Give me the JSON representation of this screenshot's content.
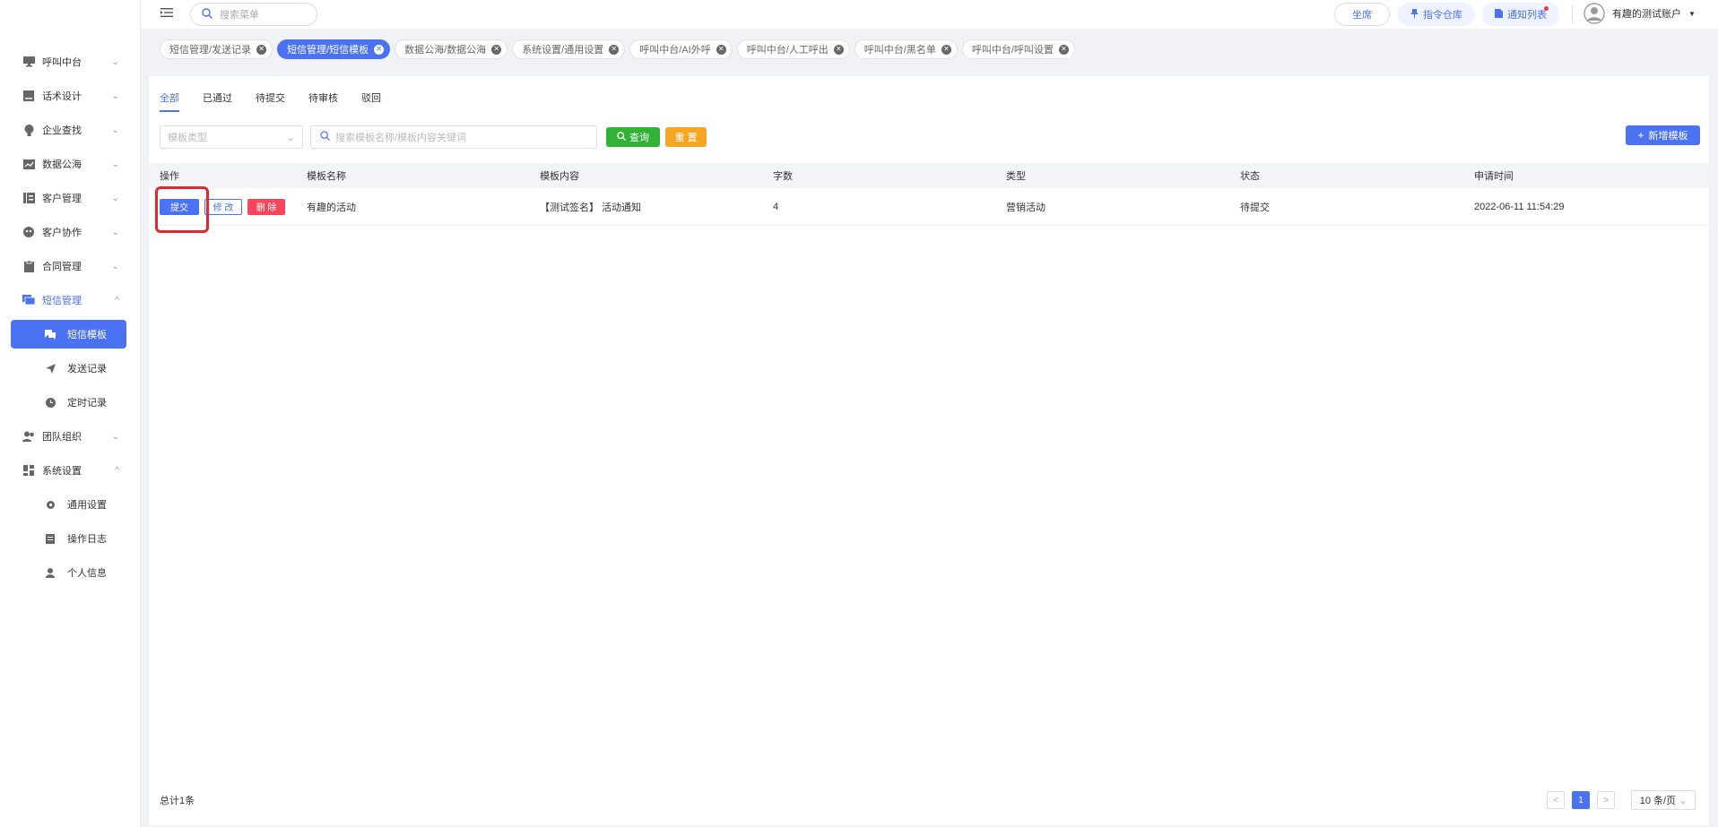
{
  "topbar": {
    "search_placeholder": "搜索菜单",
    "seat_label": "坐席",
    "command_label": "指令仓库",
    "notice_label": "通知列表",
    "user_name": "有趣的测试账户"
  },
  "sidebar": {
    "items": [
      {
        "label": "呼叫中台",
        "icon": "monitor-icon",
        "arrow": "v"
      },
      {
        "label": "话术设计",
        "icon": "script-icon",
        "arrow": "v"
      },
      {
        "label": "企业查找",
        "icon": "bulb-icon",
        "arrow": "v"
      },
      {
        "label": "数据公海",
        "icon": "chart-icon",
        "arrow": "v"
      },
      {
        "label": "客户管理",
        "icon": "customer-icon",
        "arrow": "v"
      },
      {
        "label": "客户协作",
        "icon": "globe-icon",
        "arrow": "v"
      },
      {
        "label": "合同管理",
        "icon": "clipboard-icon",
        "arrow": "v"
      },
      {
        "label": "短信管理",
        "icon": "message-icon",
        "arrow": "^"
      },
      {
        "label": "短信模板"
      },
      {
        "label": "发送记录"
      },
      {
        "label": "定时记录"
      },
      {
        "label": "团队组织",
        "icon": "team-icon",
        "arrow": "v"
      },
      {
        "label": "系统设置",
        "icon": "dashboard-icon",
        "arrow": "^"
      },
      {
        "label": "通用设置"
      },
      {
        "label": "操作日志"
      },
      {
        "label": "个人信息"
      }
    ]
  },
  "tabs": [
    {
      "label": "短信管理/发送记录"
    },
    {
      "label": "短信管理/短信模板"
    },
    {
      "label": "数据公海/数据公海"
    },
    {
      "label": "系统设置/通用设置"
    },
    {
      "label": "呼叫中台/AI外呼"
    },
    {
      "label": "呼叫中台/人工呼出"
    },
    {
      "label": "呼叫中台/黑名单"
    },
    {
      "label": "呼叫中台/呼叫设置"
    }
  ],
  "status_tabs": [
    "全部",
    "已通过",
    "待提交",
    "待审核",
    "驳回"
  ],
  "filter": {
    "type_placeholder": "模板类型",
    "keyword_placeholder": "搜索模板名称/模板内容关键词",
    "query_label": "查询",
    "reset_label": "重 置",
    "add_label": "新增模板"
  },
  "table": {
    "headers": [
      "操作",
      "模板名称",
      "模板内容",
      "字数",
      "类型",
      "状态",
      "申请时间"
    ],
    "rows": [
      {
        "submit": "提交",
        "modify": "修 改",
        "delete": "删 除",
        "name": "有趣的活动",
        "content": "【测试签名】 活动通知",
        "chars": "4",
        "type": "营销活动",
        "status": "待提交",
        "time": "2022-06-11 11:54:29"
      }
    ]
  },
  "footer": {
    "total": "总计1条",
    "prev": "<",
    "page": "1",
    "next": ">",
    "page_size": "10 条/页"
  }
}
